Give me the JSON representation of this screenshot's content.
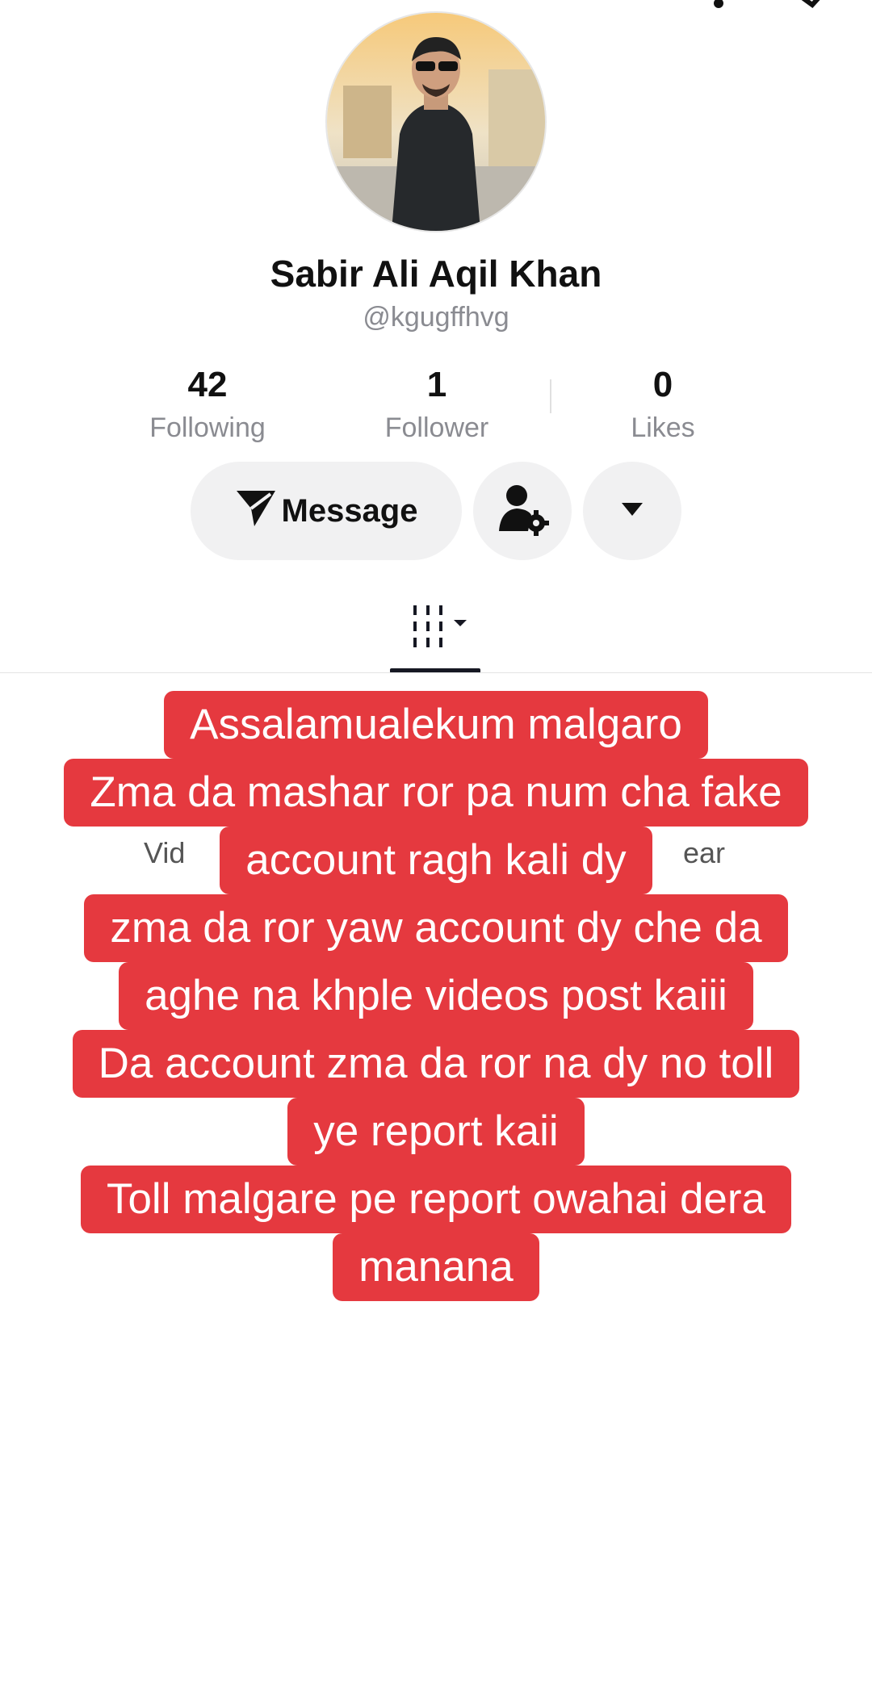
{
  "profile": {
    "name": "Sabir Ali Aqil Khan",
    "handle": "@kgugffhvg"
  },
  "stats": [
    {
      "value": "42",
      "label": "Following"
    },
    {
      "value": "1",
      "label": "Follower"
    },
    {
      "value": "0",
      "label": "Likes"
    }
  ],
  "actions": {
    "message_label": "Message"
  },
  "behind_caption": {
    "left_fragment": "Vid",
    "right_fragment": "ear"
  },
  "caption_lines": [
    "Assalamualekum malgaro",
    "Zma da mashar ror pa num cha fake",
    "account ragh kali dy",
    "zma da ror yaw account dy che da",
    "aghe na khple videos post kaiii",
    "Da account zma da ror na dy no toll",
    "ye report kaii",
    "Toll malgare pe report owahai dera",
    "manana"
  ],
  "colors": {
    "caption_bg": "#e5393f",
    "caption_text": "#ffffff",
    "button_bg": "#f1f1f2"
  }
}
